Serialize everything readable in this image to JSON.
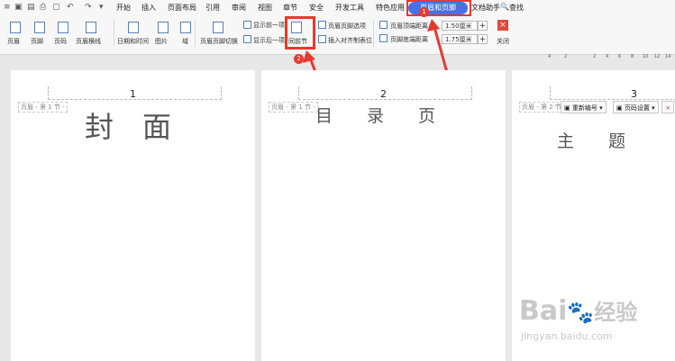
{
  "menu": {
    "items": [
      "开始",
      "插入",
      "页面布局",
      "引用",
      "审阅",
      "视图",
      "章节",
      "安全",
      "开发工具",
      "特色应用"
    ],
    "active_tab": "页眉和页脚",
    "after": "文档助手",
    "search": "查找"
  },
  "ribbon": {
    "header": "页眉",
    "footer": "页脚",
    "page_number": "页码",
    "header_line": "页眉横线",
    "date_time": "日期和时间",
    "picture": "图片",
    "field": "域",
    "switch": "页眉页脚切换",
    "show_prev": "显示前一项",
    "show_next": "显示后一项",
    "same_as_prev": "同前节",
    "options": "页眉页脚选项",
    "insert_align_tab": "插入对齐制表位",
    "header_top_dist": "页眉顶端距离",
    "footer_bottom_dist": "页脚底端距离",
    "header_top_value": "1.50厘米",
    "footer_bottom_value": "1.75厘米",
    "plus": "+",
    "close": "关闭",
    "close_icon": "×"
  },
  "ruler": {
    "ticks": [
      "4",
      "2",
      "",
      "2",
      "4",
      "6",
      "8",
      "10",
      "12",
      "14"
    ]
  },
  "pages": [
    {
      "number": "1",
      "header_label": "页眉 - 第 1 节 -",
      "title": "封　面"
    },
    {
      "number": "2",
      "header_label": "页眉 - 第 1 节 -",
      "title": "目　　录　　页"
    },
    {
      "number": "3",
      "header_label": "页眉 - 第 2 节 -",
      "title": "主　　题",
      "renumber": "重新编号",
      "page_setup": "页码设置",
      "delete": "×"
    }
  ],
  "badges": [
    "1",
    "2"
  ],
  "watermark": {
    "brand": "Bai",
    "brand2": "经验",
    "url": "jingyan.baidu.com"
  },
  "colors": {
    "accent": "#4a6fe3",
    "highlight": "#e53a2f"
  }
}
